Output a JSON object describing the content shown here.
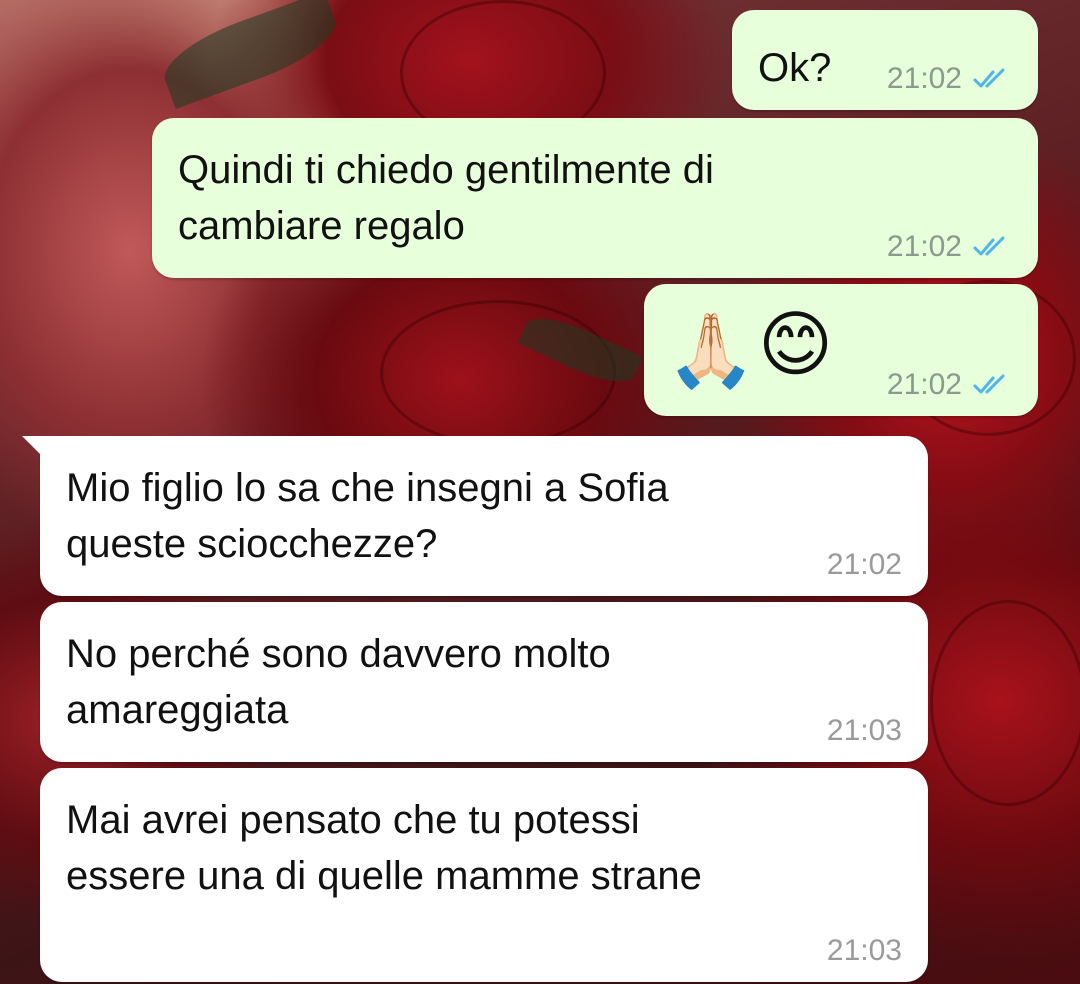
{
  "conversation": {
    "outgoing": [
      {
        "text": "Ok?",
        "time": "21:02",
        "status": "read-double-check"
      },
      {
        "text": "Quindi ti chiedo gentilmente di\ncambiare regalo",
        "time": "21:02",
        "status": "read-double-check"
      },
      {
        "emoji_1": "🙏🏻",
        "emoji_2": "😊",
        "time": "21:02",
        "status": "read-double-check"
      }
    ],
    "incoming": [
      {
        "text": "Mio figlio lo sa che insegni a Sofia\nqueste sciocchezze?",
        "time": "21:02"
      },
      {
        "text": "No perché sono davvero molto\namareggiata",
        "time": "21:03"
      },
      {
        "text": "Mai avrei pensato che tu potessi\nessere una di quelle mamme strane",
        "time": "21:03"
      }
    ]
  },
  "colors": {
    "outgoing_bubble": "#e7ffdb",
    "incoming_bubble": "#ffffff",
    "read_tick": "#4fb6ec"
  },
  "icons": {
    "read_receipt": "double-check-icon"
  }
}
